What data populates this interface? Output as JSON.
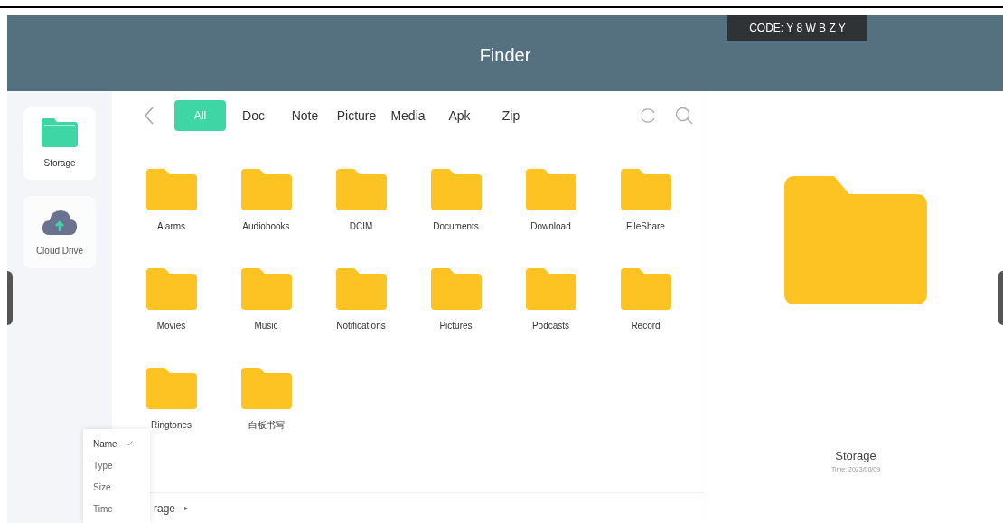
{
  "header": {
    "title": "Finder",
    "code_badge": "CODE: Y 8 W B Z Y"
  },
  "sidebar": {
    "items": [
      {
        "label": "Storage",
        "kind": "storage",
        "selected": true
      },
      {
        "label": "Cloud Drive",
        "kind": "cloud",
        "selected": false
      }
    ]
  },
  "filter_tabs": [
    {
      "label": "All",
      "selected": true
    },
    {
      "label": "Doc",
      "selected": false
    },
    {
      "label": "Note",
      "selected": false
    },
    {
      "label": "Picture",
      "selected": false
    },
    {
      "label": "Media",
      "selected": false
    },
    {
      "label": "Apk",
      "selected": false
    },
    {
      "label": "Zip",
      "selected": false
    }
  ],
  "folders": [
    "Alarms",
    "Audiobooks",
    "DCIM",
    "Documents",
    "Download",
    "FileShare",
    "Movies",
    "Music",
    "Notifications",
    "Pictures",
    "Podcasts",
    "Record",
    "Ringtones",
    "白板书写"
  ],
  "breadcrumb": {
    "text": "rage",
    "separator": "▸"
  },
  "sort_menu": [
    {
      "label": "Name",
      "selected": true
    },
    {
      "label": "Type",
      "selected": false
    },
    {
      "label": "Size",
      "selected": false
    },
    {
      "label": "Time",
      "selected": false
    }
  ],
  "details": {
    "name": "Storage",
    "time": "Time: 2023/00/09"
  }
}
